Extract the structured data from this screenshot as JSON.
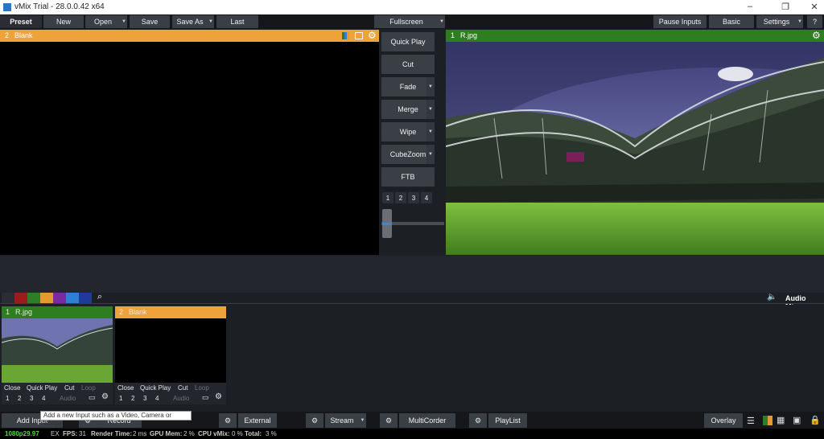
{
  "window": {
    "title": "vMix Trial - 28.0.0.42 x64",
    "minimize": "–",
    "maximize": "❐",
    "close": "✕"
  },
  "menu": {
    "preset": "Preset",
    "new": "New",
    "open": "Open",
    "save": "Save",
    "save_as": "Save As",
    "last": "Last",
    "fullscreen": "Fullscreen",
    "pause_inputs": "Pause Inputs",
    "basic": "Basic",
    "settings": "Settings",
    "help": "?"
  },
  "preview": {
    "number": "2",
    "name": "Blank"
  },
  "program": {
    "number": "1",
    "name": "R.jpg"
  },
  "transitions": {
    "quick_play": "Quick Play",
    "cut": "Cut",
    "fade": "Fade",
    "merge": "Merge",
    "wipe": "Wipe",
    "cubezoom": "CubeZoom",
    "ftb": "FTB",
    "numbers": [
      "1",
      "2",
      "3",
      "4"
    ]
  },
  "colors": {
    "swatches": [
      "#2a2e34",
      "#9b1c1c",
      "#2f7d2a",
      "#e39a2d",
      "#7a2aa0",
      "#2f7fd6",
      "#1f3a9a"
    ],
    "preview_accent": "#f0a23a",
    "program_accent": "#2e7d1e"
  },
  "audio_mixer": {
    "label": "Audio Mixer"
  },
  "inputs": [
    {
      "number": "1",
      "name": "R.jpg",
      "header_color": "#2e7d1e",
      "close": "Close",
      "quick_play": "Quick Play",
      "cut": "Cut",
      "loop": "Loop",
      "nums": [
        "1",
        "2",
        "3",
        "4"
      ],
      "audio": "Audio"
    },
    {
      "number": "2",
      "name": "Blank",
      "header_color": "#f0a23a",
      "close": "Close",
      "quick_play": "Quick Play",
      "cut": "Cut",
      "loop": "Loop",
      "nums": [
        "1",
        "2",
        "3",
        "4"
      ],
      "audio": "Audio"
    }
  ],
  "bottom": {
    "add_input": "Add Input",
    "record": "Record",
    "external": "External",
    "stream": "Stream",
    "multicorder": "MultiCorder",
    "playlist": "PlayList",
    "overlay": "Overlay",
    "tooltip": "Add a new Input such as a Video, Camera or Image"
  },
  "status": {
    "format": "1080p29.97",
    "ex": "EX",
    "fps_label": "FPS:",
    "fps": "31",
    "render_label": "Render Time:",
    "render": "2 ms",
    "gpu_label": "GPU Mem:",
    "gpu": "2 %",
    "cpu_label": "CPU vMix:",
    "cpu": "0 %",
    "total_label": "Total:",
    "total": "3 %"
  }
}
